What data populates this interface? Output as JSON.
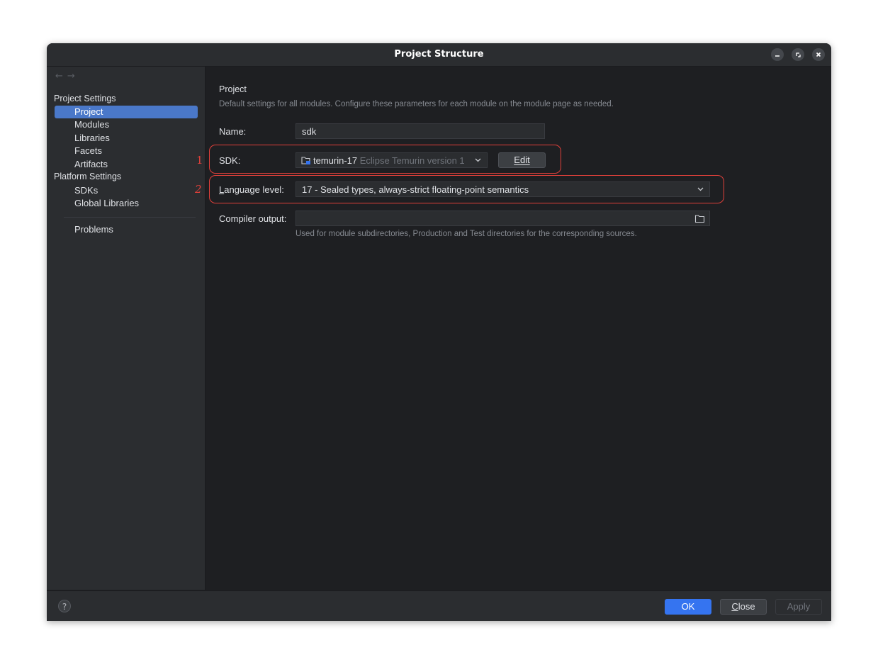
{
  "window": {
    "title": "Project Structure",
    "controls": {
      "minimize": "–",
      "maximize": "▫",
      "close": "✕"
    }
  },
  "sidebar": {
    "nav_back": "←",
    "nav_forward": "→",
    "project_settings_header": "Project Settings",
    "project_settings_items": [
      "Project",
      "Modules",
      "Libraries",
      "Facets",
      "Artifacts"
    ],
    "platform_settings_header": "Platform Settings",
    "platform_settings_items": [
      "SDKs",
      "Global Libraries"
    ],
    "problems": "Problems",
    "selected_item": "Project"
  },
  "main": {
    "section_title": "Project",
    "section_description": "Default settings for all modules. Configure these parameters for each module on the module page as needed.",
    "name_label": "Name:",
    "name_value": "sdk",
    "sdk_label": "SDK:",
    "sdk_value": "temurin-17",
    "sdk_detail": "Eclipse Temurin version 1",
    "sdk_edit_button": "Edit",
    "language_level_label_mnemonic": "L",
    "language_level_label_rest": "anguage level:",
    "language_level_value": "17 - Sealed types, always-strict floating-point semantics",
    "compiler_output_label": "Compiler output:",
    "compiler_output_value": "",
    "compiler_output_hint": "Used for module subdirectories, Production and Test directories for the corresponding sources."
  },
  "footer": {
    "help": "?",
    "ok": "OK",
    "close_mnemonic": "C",
    "close_rest": "lose",
    "apply": "Apply"
  },
  "annotations": {
    "marker_1": "1",
    "marker_2": "2"
  },
  "colors": {
    "accent": "#3574f0",
    "selection": "#4a78c9",
    "annotation": "#e0403a",
    "panel_bg": "#1e1f22",
    "sidebar_bg": "#2b2d30"
  },
  "icons": {
    "sdk_icon": "folder-sdk-icon",
    "combo_arrow": "chevron-down-icon",
    "browse": "folder-icon"
  }
}
